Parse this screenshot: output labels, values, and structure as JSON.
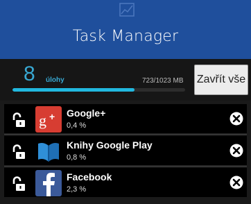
{
  "header": {
    "title": "Task Manager"
  },
  "stats": {
    "task_count": "8",
    "task_label": "úlohy",
    "memory_text": "723/1023 MB",
    "memory_fraction": 0.707
  },
  "close_all_label": "Zavřít vše",
  "apps": [
    {
      "name": "Google+",
      "usage": "0,4 %"
    },
    {
      "name": "Knihy Google Play",
      "usage": "0,8 %"
    },
    {
      "name": "Facebook",
      "usage": "2,3 %"
    }
  ],
  "colors": {
    "header_bg": "#1f4f9c",
    "accent": "#38a8d2",
    "bar_fill": "#21b8df"
  }
}
